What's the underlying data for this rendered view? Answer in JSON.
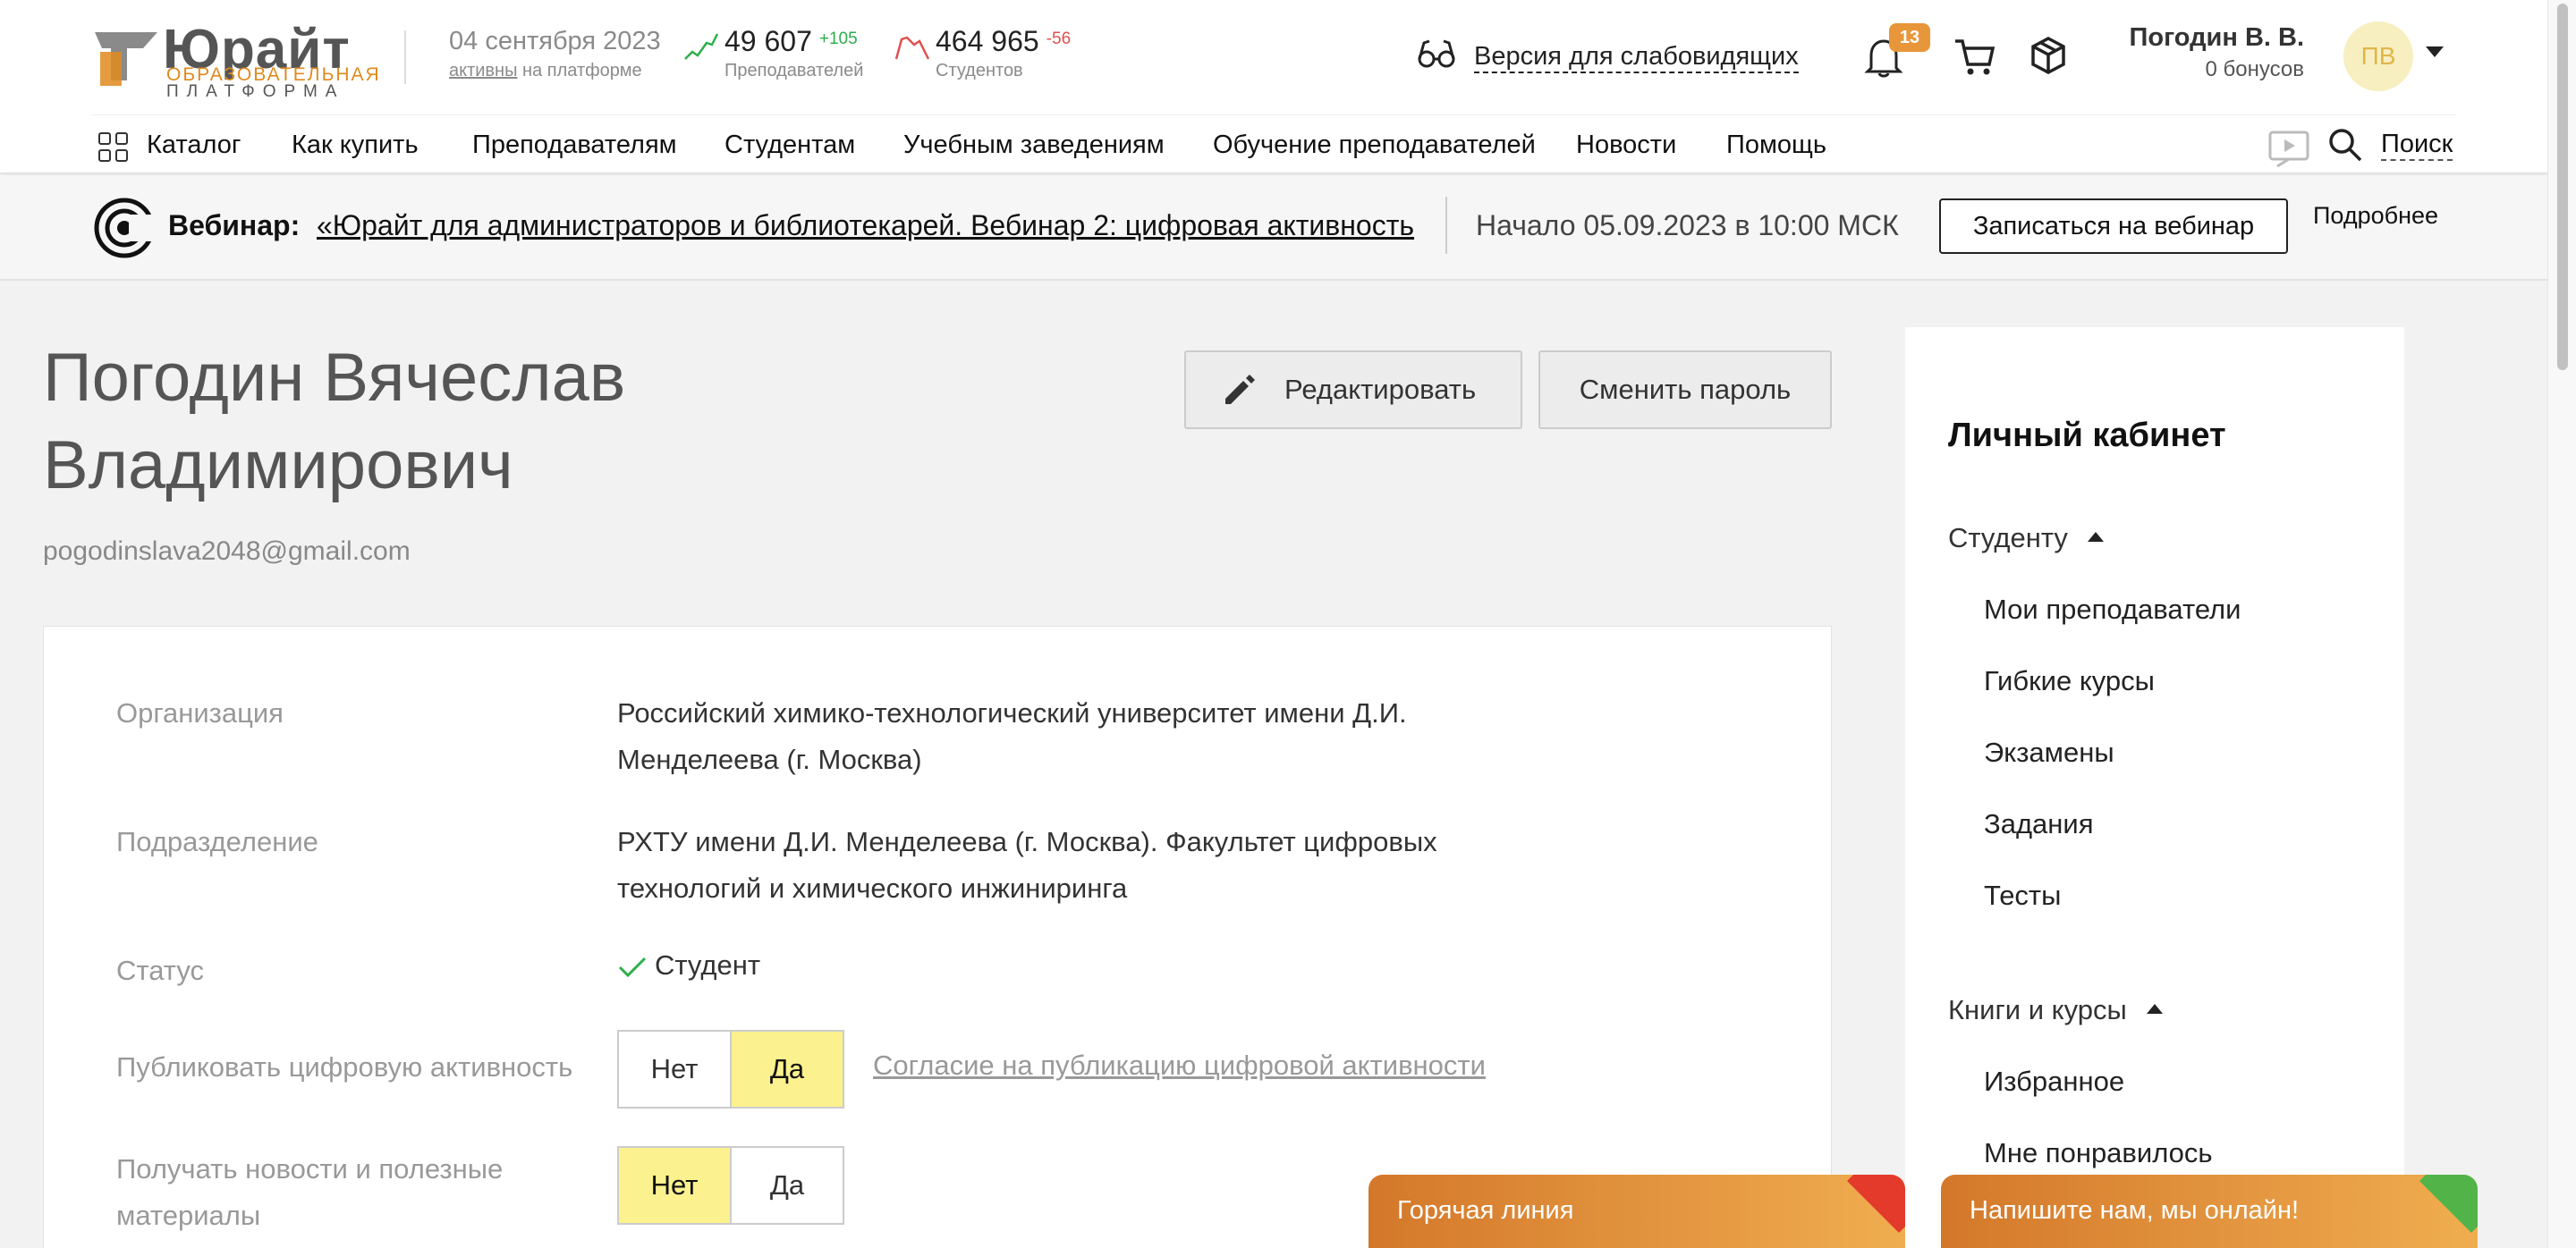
{
  "logo": {
    "name": "Юрайт",
    "sub1": "ОБРАЗОВАТЕЛЬНАЯ",
    "sub2": "ПЛАТФОРМА"
  },
  "header": {
    "date": "04 сентября 2023",
    "active_link": "активны",
    "active_rest": " на платформе",
    "teachers": {
      "count": "49 607",
      "delta": "+105",
      "label": "Преподавателей",
      "color": "#2eae4c"
    },
    "students": {
      "count": "464 965",
      "delta": "-56",
      "label": "Студентов",
      "color": "#e05050"
    },
    "accessibility": "Версия для слабовидящих",
    "notifications": "13",
    "user": {
      "name": "Погодин В. В.",
      "bonus": "0 бонусов",
      "initials": "ПВ"
    }
  },
  "nav": {
    "catalog": "Каталог",
    "items": [
      "Как купить",
      "Преподавателям",
      "Студентам",
      "Учебным заведениям",
      "Обучение преподавателей",
      "Новости",
      "Помощь"
    ],
    "search": "Поиск"
  },
  "webinar": {
    "label": "Вебинар:",
    "title": "«Юрайт для администраторов и библиотекарей. Вебинар 2: цифровая активность",
    "start": "Начало 05.09.2023 в 10:00 МСК",
    "register": "Записаться на вебинар",
    "more": "Подробнее"
  },
  "profile": {
    "first_line": "Погодин Вячеслав",
    "second_line": "Владимирович",
    "email": "pogodinslava2048@gmail.com",
    "edit": "Редактировать",
    "change_password": "Сменить пароль",
    "org_label": "Организация",
    "org_value": "Российский химико-технологический университет имени Д.И. Менделеева (г. Москва)",
    "dept_label": "Подразделение",
    "dept_value": "РХТУ имени Д.И. Менделеева (г. Москва). Факультет цифровых технологий и химического инжиниринга",
    "status_label": "Статус",
    "status_value": "Студент",
    "publish_label": "Публиковать цифровую активность",
    "publish": {
      "no": "Нет",
      "yes": "Да",
      "selected": "Да"
    },
    "consent_link": "Согласие на публикацию цифровой активности",
    "news_label": "Получать новости и полезные материалы",
    "news": {
      "no": "Нет",
      "yes": "Да",
      "selected": "Нет"
    }
  },
  "sidebar": {
    "title": "Личный кабинет",
    "student": "Студенту",
    "student_items": [
      "Мои преподаватели",
      "Гибкие курсы",
      "Экзамены",
      "Задания",
      "Тесты"
    ],
    "books": "Книги и курсы",
    "books_items": [
      "Избранное",
      "Мне понравилось"
    ]
  },
  "floating": {
    "hotline": "Горячая линия",
    "chat": "Напишите нам, мы онлайн!"
  },
  "colors": {
    "accent": "#e8963a",
    "toggle_on": "#fbf18e",
    "float_from": "#d3782a",
    "float_to": "#f0ad50"
  }
}
